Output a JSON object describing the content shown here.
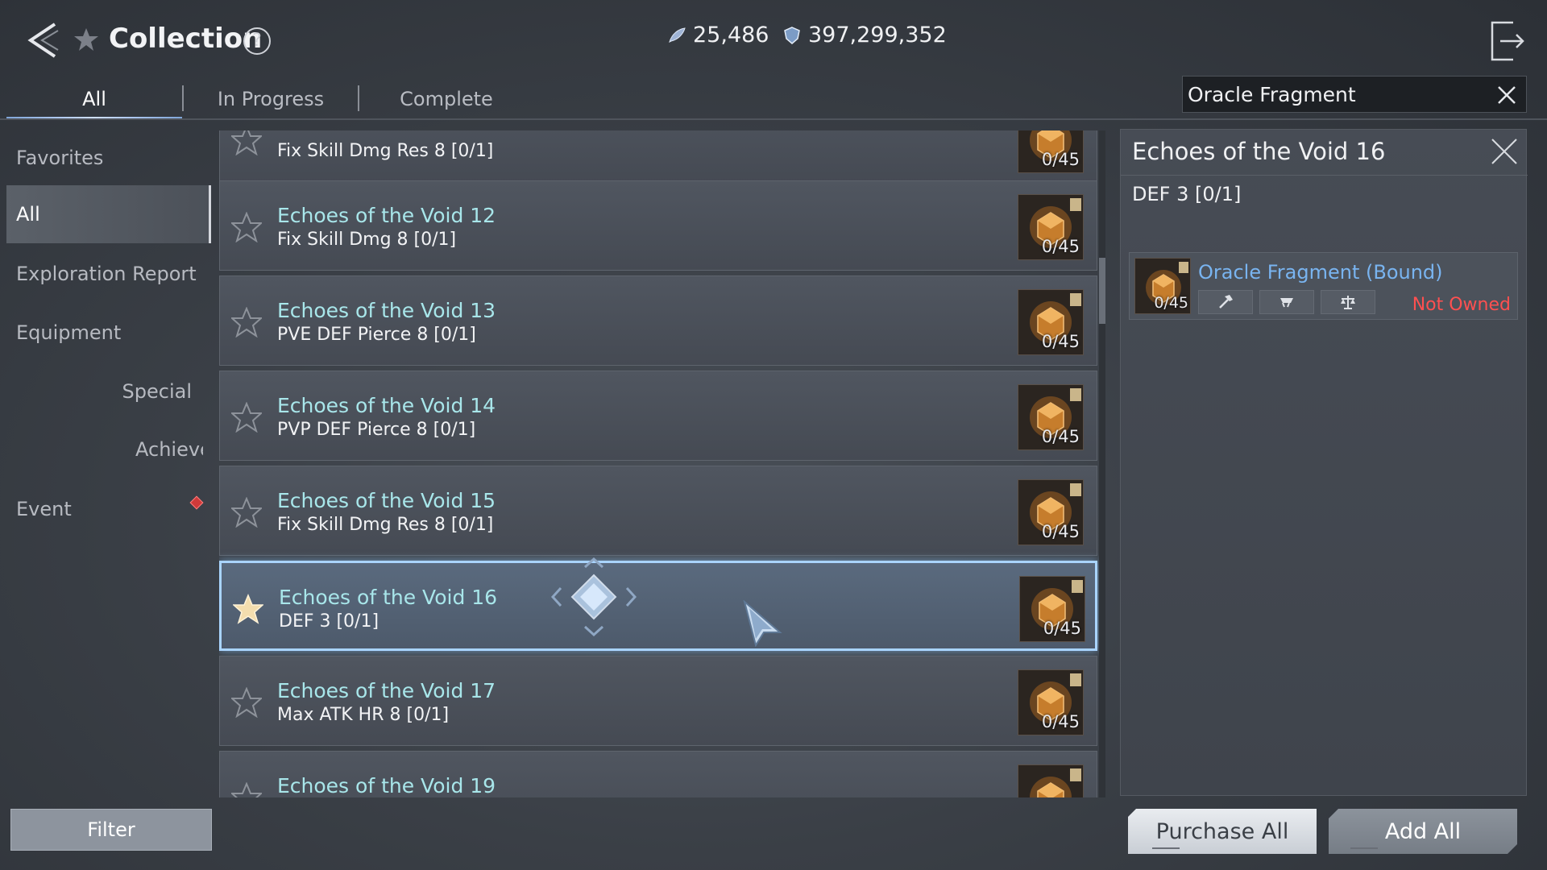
{
  "header": {
    "title": "Collection",
    "help": "?",
    "currency_1": "25,486",
    "currency_2": "397,299,352"
  },
  "tabs": [
    {
      "label": "All",
      "active": true
    },
    {
      "label": "In Progress",
      "active": false
    },
    {
      "label": "Complete",
      "active": false
    }
  ],
  "search": {
    "value": "Oracle Fragment"
  },
  "sidebar": {
    "items": [
      {
        "label": "Favorites"
      },
      {
        "label": "All"
      },
      {
        "label": "Exploration Report"
      },
      {
        "label": "Equipment"
      },
      {
        "label": "Special"
      },
      {
        "label": "Achievement"
      },
      {
        "label": "Event"
      }
    ],
    "filter_label": "Filter"
  },
  "list": {
    "rows": [
      {
        "name": "",
        "desc": "Fix Skill Dmg Res 8 [0/1]",
        "count": "0/45",
        "favorite": false
      },
      {
        "name": "Echoes of the Void 12",
        "desc": "Fix Skill Dmg 8 [0/1]",
        "count": "0/45",
        "favorite": false
      },
      {
        "name": "Echoes of the Void 13",
        "desc": "PVE DEF Pierce 8 [0/1]",
        "count": "0/45",
        "favorite": false
      },
      {
        "name": "Echoes of the Void 14",
        "desc": "PVP DEF Pierce 8 [0/1]",
        "count": "0/45",
        "favorite": false
      },
      {
        "name": "Echoes of the Void 15",
        "desc": "Fix Skill Dmg Res 8 [0/1]",
        "count": "0/45",
        "favorite": false
      },
      {
        "name": "Echoes of the Void 16",
        "desc": "DEF 3 [0/1]",
        "count": "0/45",
        "favorite": true
      },
      {
        "name": "Echoes of the Void 17",
        "desc": "Max ATK HR 8 [0/1]",
        "count": "0/45",
        "favorite": false
      },
      {
        "name": "Echoes of the Void 19",
        "desc": "",
        "count": "",
        "favorite": false
      }
    ]
  },
  "detail": {
    "title": "Echoes of the Void 16",
    "stat": "DEF 3 [0/1]",
    "material": {
      "name": "Oracle Fragment (Bound)",
      "count": "0/45",
      "status": "Not Owned",
      "actions": [
        "hammer-icon",
        "cart-icon",
        "scale-icon"
      ]
    }
  },
  "buttons": {
    "purchase_all": "Purchase All",
    "add_all": "Add All"
  },
  "colors": {
    "accent_name": "#a8e6ea",
    "material_name": "#79b4f0",
    "not_owned": "#ff5050",
    "selected_border": "#a9d4ff"
  }
}
